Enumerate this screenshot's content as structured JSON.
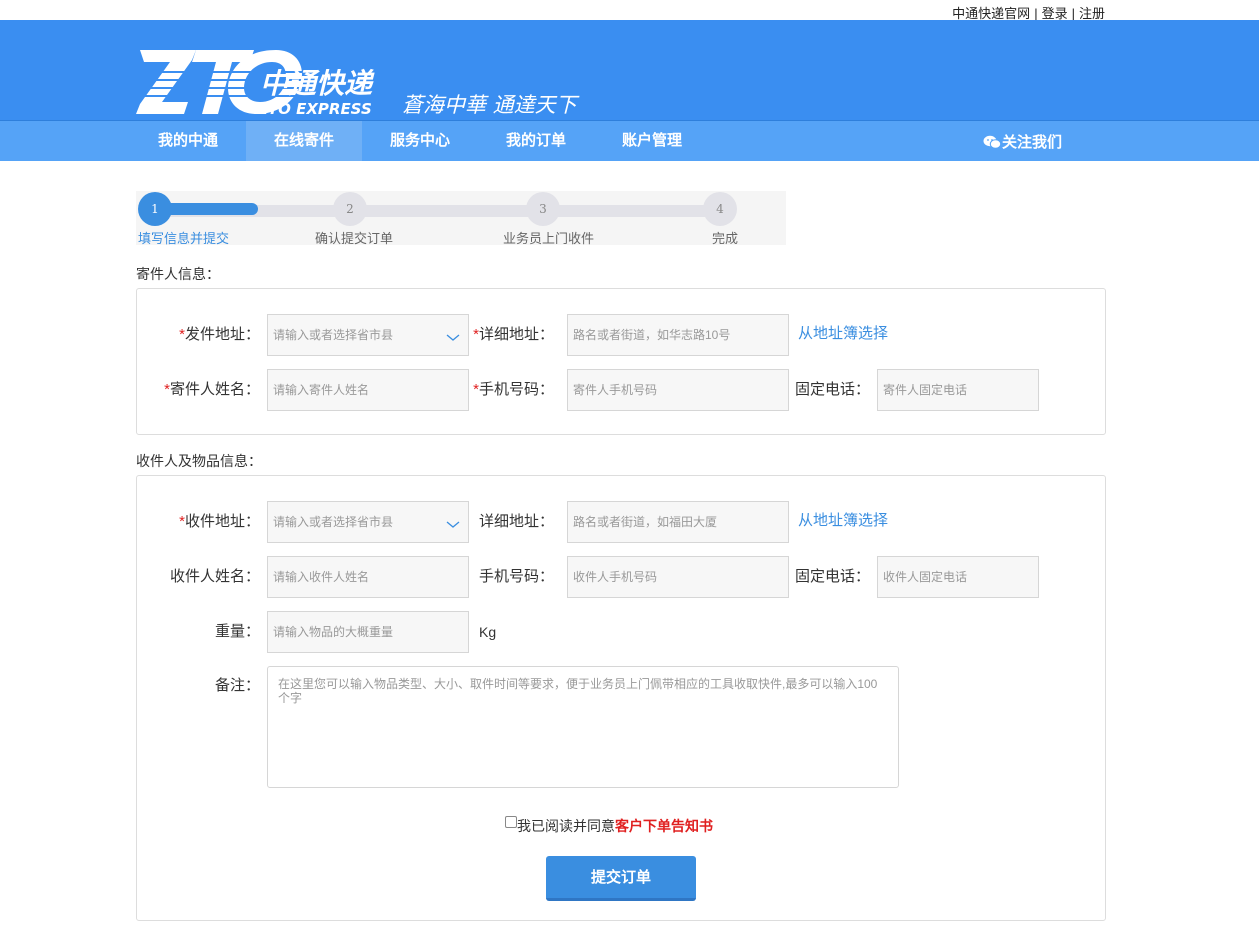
{
  "topbar": {
    "official_site": "中通快递官网",
    "login": "登录",
    "register": "注册"
  },
  "logo": {
    "brand_cn": "中通快递",
    "brand_en": "ZTO EXPRESS",
    "slogan": "蒼海中華 通達天下"
  },
  "nav": {
    "items": [
      {
        "label": "我的中通"
      },
      {
        "label": "在线寄件",
        "active": true
      },
      {
        "label": "服务中心"
      },
      {
        "label": "我的订单"
      },
      {
        "label": "账户管理"
      }
    ],
    "follow": "关注我们"
  },
  "steps": [
    {
      "num": "1",
      "label": "填写信息并提交",
      "active": true
    },
    {
      "num": "2",
      "label": "确认提交订单"
    },
    {
      "num": "3",
      "label": "业务员上门收件"
    },
    {
      "num": "4",
      "label": "完成"
    }
  ],
  "progress_fraction": 0.18,
  "sender": {
    "title": "寄件人信息：",
    "address_label": "发件地址：",
    "address_placeholder": "请输入或者选择省市县",
    "detail_label": "详细地址：",
    "detail_placeholder": "路名或者街道，如华志路10号",
    "address_book": "从地址簿选择",
    "name_label": "寄件人姓名：",
    "name_placeholder": "请输入寄件人姓名",
    "phone_label": "手机号码：",
    "phone_placeholder": "寄件人手机号码",
    "tel_label": "固定电话：",
    "tel_placeholder": "寄件人固定电话"
  },
  "receiver": {
    "title": "收件人及物品信息：",
    "address_label": "收件地址：",
    "address_placeholder": "请输入或者选择省市县",
    "detail_label": "详细地址：",
    "detail_placeholder": "路名或者街道，如福田大厦",
    "address_book": "从地址簿选择",
    "name_label": "收件人姓名：",
    "name_placeholder": "请输入收件人姓名",
    "phone_label": "手机号码：",
    "phone_placeholder": "收件人手机号码",
    "tel_label": "固定电话：",
    "tel_placeholder": "收件人固定电话",
    "weight_label": "重量：",
    "weight_placeholder": "请输入物品的大概重量",
    "weight_unit": "Kg",
    "remark_label": "备注：",
    "remark_placeholder": "在这里您可以输入物品类型、大小、取件时间等要求，便于业务员上门佩带相应的工具收取快件,最多可以输入100个字"
  },
  "agreement": {
    "text": "我已阅读并同意",
    "link": "客户下单告知书"
  },
  "submit_label": "提交订单",
  "colors": {
    "header_blue": "#3a8ef1",
    "nav_blue": "#55a3f7",
    "accent": "#3a8ee0",
    "required": "#e02020"
  }
}
